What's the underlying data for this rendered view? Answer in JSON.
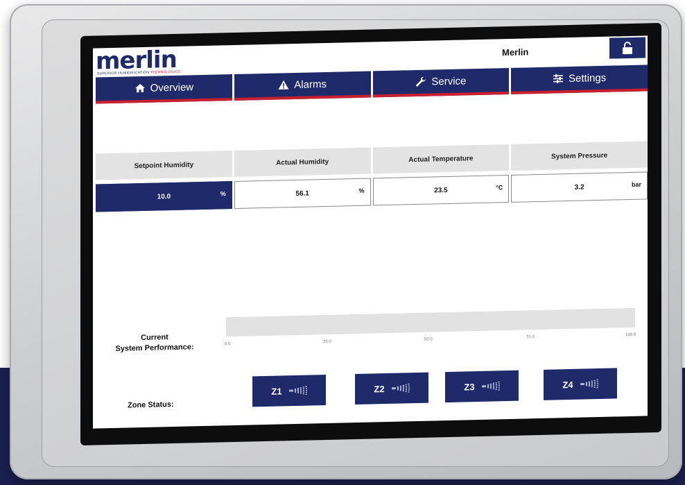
{
  "header": {
    "logo_text": "merlin",
    "logo_subtext_a": "SUPERIOR HUMIDIFICATION",
    "logo_subtext_b": "TECHNOLOGIES",
    "user_name": "Merlin",
    "lock_icon": "unlock-icon"
  },
  "nav": {
    "tabs": [
      {
        "label": "Overview",
        "icon": "home-icon"
      },
      {
        "label": "Alarms",
        "icon": "warning-icon"
      },
      {
        "label": "Service",
        "icon": "wrench-icon"
      },
      {
        "label": "Settings",
        "icon": "sliders-icon"
      }
    ]
  },
  "readings": {
    "headers": [
      "Setpoint Humidity",
      "Actual Humidity",
      "Actual Temperature",
      "System Pressure"
    ],
    "values": [
      {
        "value": "10.0",
        "unit": "%"
      },
      {
        "value": "56.1",
        "unit": "%"
      },
      {
        "value": "23.5",
        "unit": "°C"
      },
      {
        "value": "3.2",
        "unit": "bar"
      }
    ]
  },
  "performance": {
    "label_line1": "Current",
    "label_line2": "System Performance:",
    "value_percent": 0,
    "ticks": [
      "0.0",
      "25.0",
      "50.0",
      "75.0",
      "100.0"
    ]
  },
  "zones": {
    "label": "Zone Status:",
    "items": [
      {
        "label": "Z1",
        "icon": "nozzle-spray-icon"
      },
      {
        "label": "Z2",
        "icon": "nozzle-spray-icon"
      },
      {
        "label": "Z3",
        "icon": "nozzle-spray-icon"
      },
      {
        "label": "Z4",
        "icon": "nozzle-spray-icon"
      }
    ]
  },
  "colors": {
    "primary": "#1f2a6b",
    "accent": "#c8202f",
    "header_gray": "#e3e3e3",
    "background_band": "#1b2150"
  }
}
